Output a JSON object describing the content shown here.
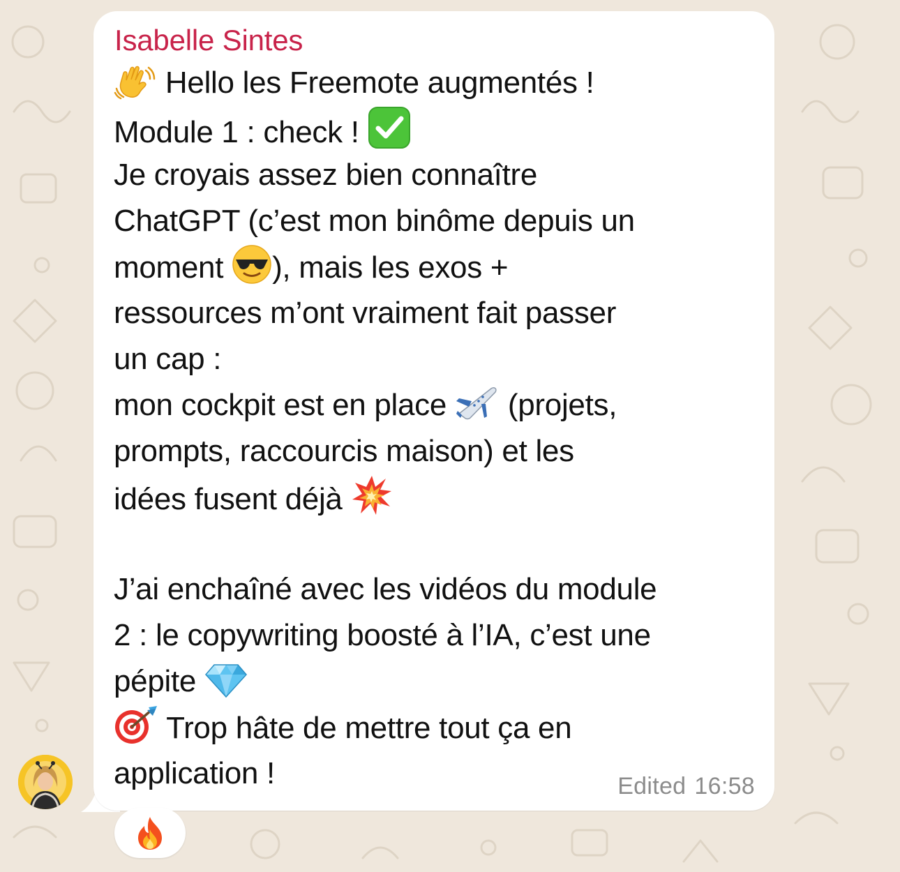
{
  "message": {
    "sender": "Isabelle Sintes",
    "lines": [
      {
        "type": "text",
        "parts": [
          {
            "emoji": "waving-hand-icon"
          },
          {
            "text": " Hello les Freemote augmentés !"
          }
        ]
      },
      {
        "type": "text",
        "parts": [
          {
            "text": "Module 1 : check ! "
          },
          {
            "emoji": "check-mark-button-icon"
          }
        ]
      },
      {
        "type": "text",
        "parts": [
          {
            "text": "Je croyais assez bien connaître"
          }
        ]
      },
      {
        "type": "text",
        "parts": [
          {
            "text": "ChatGPT (c’est mon binôme depuis un"
          }
        ]
      },
      {
        "type": "text",
        "parts": [
          {
            "text": "moment "
          },
          {
            "emoji": "sunglasses-face-icon"
          },
          {
            "text": "), mais les exos +"
          }
        ]
      },
      {
        "type": "text",
        "parts": [
          {
            "text": "ressources m’ont vraiment fait passer"
          }
        ]
      },
      {
        "type": "text",
        "parts": [
          {
            "text": "un cap :"
          }
        ]
      },
      {
        "type": "text",
        "parts": [
          {
            "text": "mon cockpit est en place "
          },
          {
            "emoji": "airplane-icon"
          },
          {
            "text": " (projets,"
          }
        ]
      },
      {
        "type": "text",
        "parts": [
          {
            "text": "prompts, raccourcis maison) et les"
          }
        ]
      },
      {
        "type": "text",
        "parts": [
          {
            "text": "idées fusent déjà "
          },
          {
            "emoji": "collision-icon"
          }
        ]
      },
      {
        "type": "blank",
        "parts": []
      },
      {
        "type": "text",
        "parts": [
          {
            "text": "J’ai enchaîné avec les vidéos du module"
          }
        ]
      },
      {
        "type": "text",
        "parts": [
          {
            "text": "2 : le copywriting boosté à l’IA, c’est une"
          }
        ]
      },
      {
        "type": "text",
        "parts": [
          {
            "text": "pépite "
          },
          {
            "emoji": "gem-stone-icon"
          }
        ]
      },
      {
        "type": "text",
        "parts": [
          {
            "emoji": "direct-hit-icon"
          },
          {
            "text": " Trop hâte de mettre tout ça en"
          }
        ]
      },
      {
        "type": "text",
        "parts": [
          {
            "text": "application !"
          }
        ]
      }
    ],
    "edited_label": "Edited",
    "time": "16:58",
    "reaction": "fire-icon"
  },
  "colors": {
    "sender_name": "#c8234a",
    "bubble": "#ffffff",
    "background": "#efe7dc",
    "meta_text": "#8c8c8c"
  }
}
